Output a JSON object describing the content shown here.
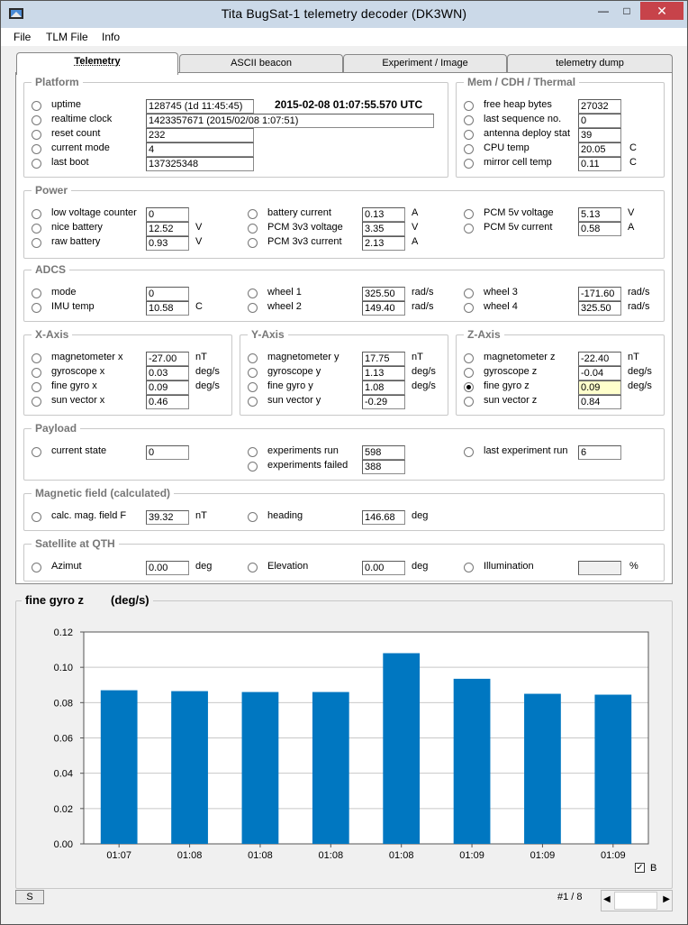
{
  "window": {
    "title": "Tita BugSat-1 telemetry decoder (DK3WN)",
    "minimize_icon": "minimize-icon",
    "maximize_icon": "maximize-icon",
    "close_icon": "close-icon"
  },
  "menu": [
    "File",
    "TLM File",
    "Info"
  ],
  "tabs": [
    "Telemetry",
    "ASCII beacon",
    "Experiment / Image",
    "telemetry dump"
  ],
  "platform": {
    "title": "Platform",
    "timestamp": "2015-02-08 01:07:55.570 UTC",
    "rows": [
      {
        "label": "uptime",
        "value": "128745  (1d 11:45:45)"
      },
      {
        "label": "realtime clock",
        "value": "1423357671  (2015/02/08 1:07:51)"
      },
      {
        "label": "reset count",
        "value": "232"
      },
      {
        "label": "current mode",
        "value": "4"
      },
      {
        "label": "last boot",
        "value": "137325348"
      }
    ]
  },
  "mem": {
    "title": "Mem / CDH / Thermal",
    "rows": [
      {
        "label": "free heap bytes",
        "value": "27032",
        "unit": ""
      },
      {
        "label": "last sequence no.",
        "value": "0",
        "unit": ""
      },
      {
        "label": "antenna deploy stat",
        "value": "39",
        "unit": ""
      },
      {
        "label": "CPU temp",
        "value": "20.05",
        "unit": "C"
      },
      {
        "label": "mirror cell temp",
        "value": "0.11",
        "unit": "C"
      }
    ]
  },
  "power": {
    "title": "Power",
    "col1": [
      {
        "label": "low voltage counter",
        "value": "0",
        "unit": ""
      },
      {
        "label": "nice battery",
        "value": "12.52",
        "unit": "V"
      },
      {
        "label": "raw battery",
        "value": "0.93",
        "unit": "V"
      }
    ],
    "col2": [
      {
        "label": "battery current",
        "value": "0.13",
        "unit": "A"
      },
      {
        "label": "PCM 3v3 voltage",
        "value": "3.35",
        "unit": "V"
      },
      {
        "label": "PCM 3v3 current",
        "value": "2.13",
        "unit": "A"
      }
    ],
    "col3": [
      {
        "label": "PCM 5v voltage",
        "value": "5.13",
        "unit": "V"
      },
      {
        "label": "PCM 5v current",
        "value": "0.58",
        "unit": "A"
      }
    ]
  },
  "adcs": {
    "title": "ADCS",
    "col1": [
      {
        "label": "mode",
        "value": "0",
        "unit": ""
      },
      {
        "label": "IMU temp",
        "value": "10.58",
        "unit": "C"
      }
    ],
    "col2": [
      {
        "label": "wheel 1",
        "value": "325.50",
        "unit": "rad/s"
      },
      {
        "label": "wheel 2",
        "value": "149.40",
        "unit": "rad/s"
      }
    ],
    "col3": [
      {
        "label": "wheel 3",
        "value": "-171.60",
        "unit": "rad/s"
      },
      {
        "label": "wheel 4",
        "value": "325.50",
        "unit": "rad/s"
      }
    ]
  },
  "xaxis": {
    "title": "X-Axis",
    "rows": [
      {
        "label": "magnetometer x",
        "value": "-27.00",
        "unit": "nT"
      },
      {
        "label": "gyroscope x",
        "value": "0.03",
        "unit": "deg/s"
      },
      {
        "label": "fine gyro x",
        "value": "0.09",
        "unit": "deg/s"
      },
      {
        "label": "sun vector x",
        "value": "0.46",
        "unit": ""
      }
    ]
  },
  "yaxis": {
    "title": "Y-Axis",
    "rows": [
      {
        "label": "magnetometer y",
        "value": "17.75",
        "unit": "nT"
      },
      {
        "label": "gyroscope y",
        "value": "1.13",
        "unit": "deg/s"
      },
      {
        "label": "fine gyro y",
        "value": "1.08",
        "unit": "deg/s"
      },
      {
        "label": "sun vector y",
        "value": "-0.29",
        "unit": ""
      }
    ]
  },
  "zaxis": {
    "title": "Z-Axis",
    "rows": [
      {
        "label": "magnetometer z",
        "value": "-22.40",
        "unit": "nT"
      },
      {
        "label": "gyroscope z",
        "value": "-0.04",
        "unit": "deg/s"
      },
      {
        "label": "fine gyro z",
        "value": "0.09",
        "unit": "deg/s"
      },
      {
        "label": "sun vector z",
        "value": "0.84",
        "unit": ""
      }
    ]
  },
  "payload": {
    "title": "Payload",
    "current_state_label": "current state",
    "current_state_value": "0",
    "exp_run_label": "experiments run",
    "exp_run_value": "598",
    "exp_failed_label": "experiments failed",
    "exp_failed_value": "388",
    "last_exp_label": "last experiment run",
    "last_exp_value": "6"
  },
  "magfield": {
    "title": "Magnetic field (calculated)",
    "calc_label": "calc. mag. field F",
    "calc_value": "39.32",
    "calc_unit": "nT",
    "heading_label": "heading",
    "heading_value": "146.68",
    "heading_unit": "deg"
  },
  "qth": {
    "title": "Satellite at QTH",
    "azimut_label": "Azimut",
    "azimut_value": "0.00",
    "azimut_unit": "deg",
    "elev_label": "Elevation",
    "elev_value": "0.00",
    "elev_unit": "deg",
    "illum_label": "Illumination",
    "illum_value": "",
    "illum_unit": "%"
  },
  "chart_header": {
    "name": "fine gyro z",
    "unit": "(deg/s)"
  },
  "chart_data": {
    "type": "bar",
    "title": "fine gyro z",
    "ylabel": "(deg/s)",
    "xlabel": "",
    "categories": [
      "01:07",
      "01:08",
      "01:08",
      "01:08",
      "01:08",
      "01:09",
      "01:09",
      "01:09"
    ],
    "values": [
      0.087,
      0.0865,
      0.086,
      0.086,
      0.108,
      0.0935,
      0.085,
      0.0845
    ],
    "ylim": [
      0,
      0.12
    ],
    "yticks": [
      "0.12",
      "0.10",
      "0.08",
      "0.06",
      "0.04",
      "0.02",
      "0.00"
    ],
    "grid": true,
    "bar_color": "#0077c1"
  },
  "footer": {
    "s_button": "S",
    "record_counter": "#1 / 8",
    "checkbox_label": "B"
  }
}
